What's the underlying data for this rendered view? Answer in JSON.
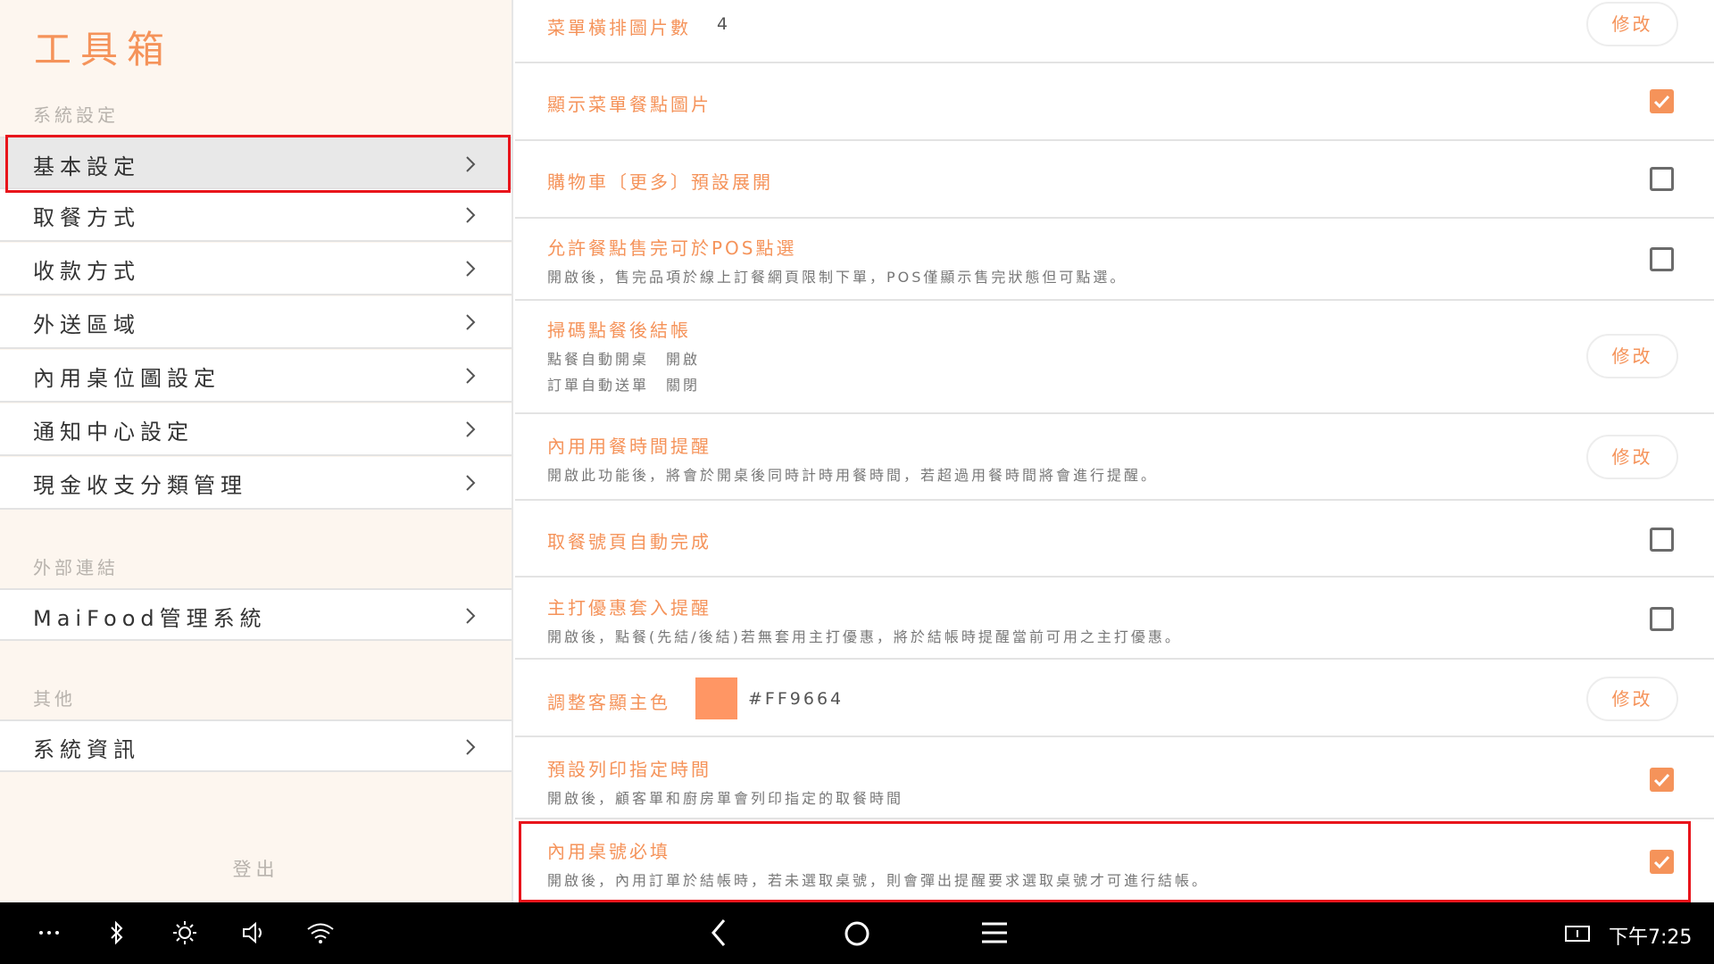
{
  "app": {
    "title": "工具箱"
  },
  "sidebar": {
    "sections": [
      {
        "label": "系統設定",
        "items": [
          {
            "label": "基本設定",
            "active": true
          },
          {
            "label": "取餐方式"
          },
          {
            "label": "收款方式"
          },
          {
            "label": "外送區域"
          },
          {
            "label": "內用桌位圖設定"
          },
          {
            "label": "通知中心設定"
          },
          {
            "label": "現金收支分類管理"
          }
        ]
      },
      {
        "label": "外部連結",
        "items": [
          {
            "label": "MaiFood管理系統"
          }
        ]
      },
      {
        "label": "其他",
        "items": [
          {
            "label": "系統資訊"
          }
        ]
      }
    ],
    "logout_label": "登出"
  },
  "settings": {
    "edit_label": "修改",
    "rows": [
      {
        "title": "菜單橫排圖片數",
        "value": "4",
        "control": "edit"
      },
      {
        "title": "顯示菜單餐點圖片",
        "control": "checkbox",
        "checked": true
      },
      {
        "title": "購物車〔更多〕預設展開",
        "control": "checkbox",
        "checked": false
      },
      {
        "title": "允許餐點售完可於POS點選",
        "desc": [
          "開啟後，售完品項於線上訂餐網頁限制下單，POS僅顯示售完狀態但可點選。"
        ],
        "control": "checkbox",
        "checked": false
      },
      {
        "title": "掃碼點餐後結帳",
        "desc": [
          "點餐自動開桌　開啟",
          "訂單自動送單　關閉"
        ],
        "control": "edit"
      },
      {
        "title": "內用用餐時間提醒",
        "desc": [
          "開啟此功能後，將會於開桌後同時計時用餐時間，若超過用餐時間將會進行提醒。"
        ],
        "control": "edit"
      },
      {
        "title": "取餐號頁自動完成",
        "control": "checkbox",
        "checked": false
      },
      {
        "title": "主打優惠套入提醒",
        "desc": [
          "開啟後，點餐(先結/後結)若無套用主打優惠，將於結帳時提醒當前可用之主打優惠。"
        ],
        "control": "checkbox",
        "checked": false
      },
      {
        "title": "調整客顯主色",
        "value": "#FF9664",
        "control": "edit"
      },
      {
        "title": "預設列印指定時間",
        "desc": [
          "開啟後，顧客單和廚房單會列印指定的取餐時間"
        ],
        "control": "checkbox",
        "checked": true
      },
      {
        "title": "內用桌號必填",
        "desc": [
          "開啟後，內用訂單於結帳時，若未選取桌號，則會彈出提醒要求選取桌號才可進行結帳。"
        ],
        "control": "checkbox",
        "checked": true
      }
    ]
  },
  "system_bar": {
    "icons": [
      "more-icon",
      "bluetooth-icon",
      "brightness-icon",
      "volume-icon",
      "wifi-icon",
      "back-icon",
      "home-icon",
      "menu-icon",
      "screen-icon"
    ],
    "clock": "下午7:25"
  },
  "colors": {
    "accent": "#F5935A",
    "customer_display_color": "#FF9664",
    "sidebar_bg": "#FDF6EF",
    "highlight": "#E8141B"
  }
}
